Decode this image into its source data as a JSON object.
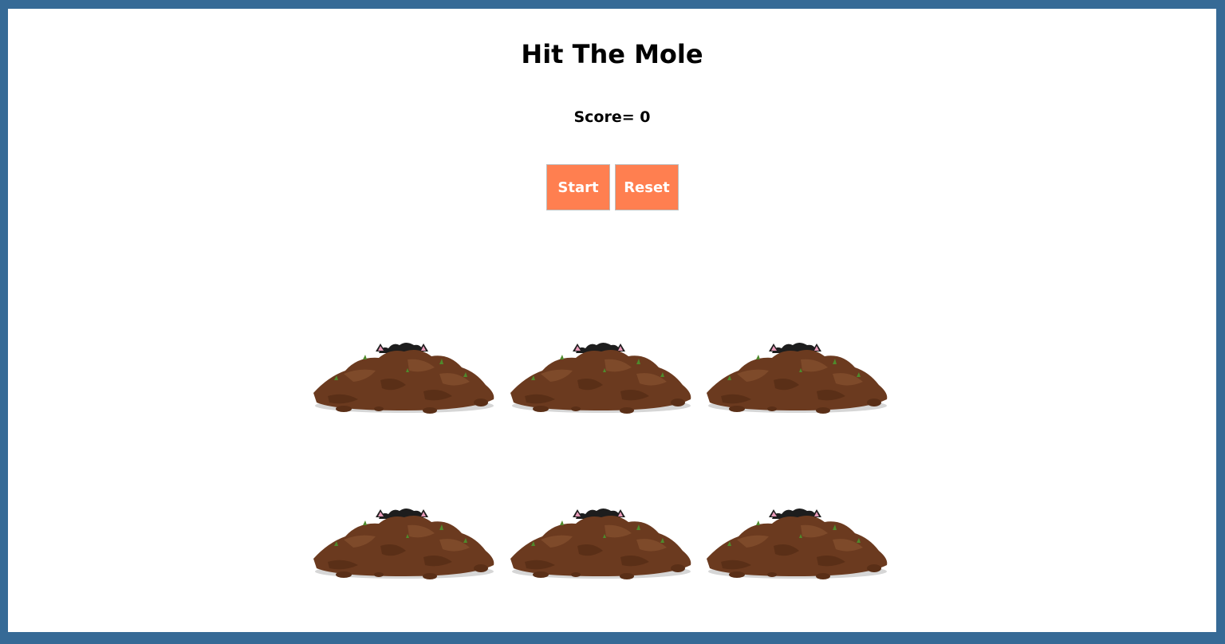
{
  "game": {
    "title": "Hit The Mole",
    "score_text": "Score= 0",
    "score": 0,
    "buttons": {
      "start_label": "Start",
      "reset_label": "Reset",
      "color": "#ff7f50"
    },
    "holes": [
      {
        "id": 1,
        "icon": "dirt-mound-icon"
      },
      {
        "id": 2,
        "icon": "dirt-mound-icon"
      },
      {
        "id": 3,
        "icon": "dirt-mound-icon"
      },
      {
        "id": 4,
        "icon": "dirt-mound-icon"
      },
      {
        "id": 5,
        "icon": "dirt-mound-icon"
      },
      {
        "id": 6,
        "icon": "dirt-mound-icon"
      }
    ]
  },
  "colors": {
    "page_border": "#366a96",
    "background": "#ffffff",
    "dirt": "#6b3a1f",
    "button": "#ff7f50"
  }
}
